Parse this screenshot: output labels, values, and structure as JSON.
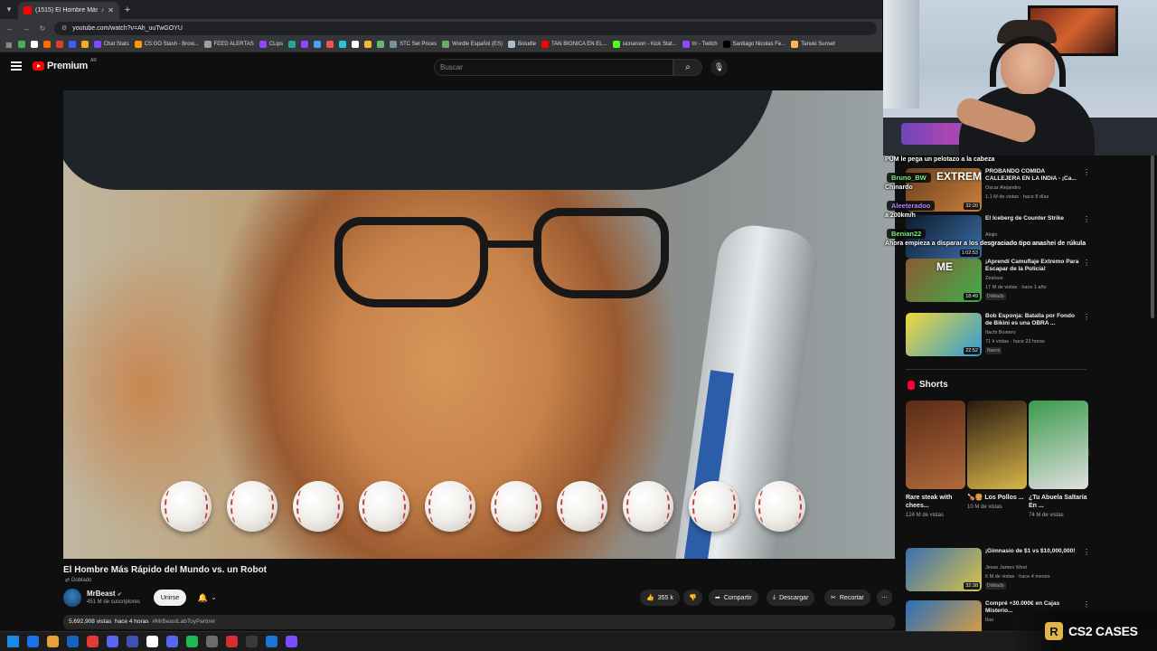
{
  "browser": {
    "tab_title": "(1515) El Hombre Más Rápi...",
    "url": "youtube.com/watch?v=Ah_uuTwGOYU",
    "bookmarks": [
      {
        "label": "",
        "color": "#4caf50"
      },
      {
        "label": "",
        "color": "#ffffff"
      },
      {
        "label": "",
        "color": "#ff6d00"
      },
      {
        "label": "",
        "color": "#e53935"
      },
      {
        "label": "",
        "color": "#3d5afe"
      },
      {
        "label": "",
        "color": "#f9a825"
      },
      {
        "label": "Chat Stats",
        "color": "#7c4dff"
      },
      {
        "label": "CS:GO Stash - Brow...",
        "color": "#ff9800"
      },
      {
        "label": "FEED ALERTAS",
        "color": "#9e9e9e"
      },
      {
        "label": "CLips",
        "color": "#9146ff"
      },
      {
        "label": "",
        "color": "#26a69a"
      },
      {
        "label": "",
        "color": "#9146ff"
      },
      {
        "label": "",
        "color": "#42a5f5"
      },
      {
        "label": "",
        "color": "#ef5350"
      },
      {
        "label": "",
        "color": "#26c6da"
      },
      {
        "label": "",
        "color": "#ffffff"
      },
      {
        "label": "",
        "color": "#f3ba2f"
      },
      {
        "label": "",
        "color": "#66bb6a"
      },
      {
        "label": "STC Set Prices",
        "color": "#78909c"
      },
      {
        "label": "Wordle Español (ES)",
        "color": "#6aaa64"
      },
      {
        "label": "Boludle",
        "color": "#b0bec5"
      },
      {
        "label": "TAN BIONICA EN EL...",
        "color": "#ff0000"
      },
      {
        "label": "sicnaroon - Kick Stat...",
        "color": "#53fc18"
      },
      {
        "label": "trr - Twitch",
        "color": "#9146ff"
      },
      {
        "label": "Santiago Nicolas Fe...",
        "color": "#000000"
      },
      {
        "label": "Tanuki Sunset",
        "color": "#ffb74d"
      }
    ]
  },
  "header": {
    "brand": "Premium",
    "country": "AR",
    "search_placeholder": "Buscar"
  },
  "video": {
    "title": "El Hombre Más Rápido del Mundo vs. un Robot",
    "dubbed": "Doblado",
    "channel": "MrBeast",
    "subscribers": "451 M de suscriptores",
    "join_label": "Unirse",
    "likes": "355 k",
    "share_label": "Compartir",
    "download_label": "Descargar",
    "clip_label": "Recortar",
    "views": "5,692,908 vistas",
    "age": "hace 4 horas",
    "hashtag": "#MrBeastLabToyPartner"
  },
  "recommendations": [
    {
      "title": "PROBANDO COMIDA CALLEJERA EN LA INDIA - ¡Ca...",
      "channel": "Oscar Alejandro",
      "meta": "1.1 M de vistas · hace 8 días",
      "duration": "32:20",
      "badge": "",
      "thumb_text": "EXTREMO!",
      "colors": [
        "#6b3f1f",
        "#c8803a"
      ]
    },
    {
      "title": "El Iceberg de Counter Strike",
      "channel": "Alojin",
      "meta": "3.6 k vistas · hace 22 horas",
      "duration": "1:02:53",
      "badge": "",
      "thumb_text": "",
      "colors": [
        "#0d1a2b",
        "#3b6ea8"
      ]
    },
    {
      "title": "¡Aprendí Camuflaje Extremo Para Escapar de la Policía!",
      "channel": "Zealous",
      "meta": "17 M de vistas · hace 1 año",
      "duration": "18:49",
      "badge": "Doblado",
      "thumb_text": "ME",
      "colors": [
        "#8a5b33",
        "#3fae4a"
      ]
    },
    {
      "title": "Bob Esponja: Batalla por Fondo de Bikini es una OBRA ...",
      "channel": "Itachi Bostero",
      "meta": "71 k vistas · hace 23 horas",
      "duration": "22:52",
      "badge": "Nuevo",
      "thumb_text": "",
      "colors": [
        "#f2d73a",
        "#2e9bd6"
      ]
    },
    {
      "title": "¡Gimnasio de $1 vs $10,000,000!",
      "channel": "Jesse James West",
      "meta": "6 M de vistas · hace 4 meses",
      "duration": "32:38",
      "badge": "Doblado",
      "thumb_text": "",
      "colors": [
        "#3a6fb0",
        "#d9c24a"
      ]
    },
    {
      "title": "Compré +30.000€ en Cajas Misterio...",
      "channel": "Ibai",
      "meta": "",
      "duration": "",
      "badge": "",
      "thumb_text": "",
      "colors": [
        "#2a6fb8",
        "#e8a23a"
      ]
    }
  ],
  "shorts": {
    "heading": "Shorts",
    "items": [
      {
        "title": "Rare steak with chees...",
        "views": "124 M de vistas",
        "colors": [
          "#5a2a18",
          "#b06a3a"
        ]
      },
      {
        "title": "🍗🍔 Los Pollos ...",
        "views": "10 M de vistas",
        "colors": [
          "#2a1a10",
          "#d8b54a"
        ]
      },
      {
        "title": "¿Tu Abuela Saltaría En ...",
        "views": "74 M de vistas",
        "colors": [
          "#3a9a4a",
          "#e0e0e0"
        ]
      }
    ]
  },
  "chat": [
    {
      "user": "",
      "text": "PUM le pega un pelotazo a la cabeza"
    },
    {
      "user": "Bruno_BW",
      "text": "Chinardo",
      "color": "#7cf07c"
    },
    {
      "user": "Aleeteradoo",
      "text": "a 200km/h",
      "color": "#b38cff"
    },
    {
      "user": "Benian22",
      "text": "Ahora empieza a disparar a los desgraciado tipo anashei de rúkula",
      "color": "#7cf07c"
    }
  ],
  "overlay": {
    "brand": "CS2 CASES",
    "logo_letter": "R"
  },
  "taskbar": [
    "#1e88e5",
    "#1a73e8",
    "#e8a23a",
    "#1565c0",
    "#e53935",
    "#5865f2",
    "#3f51b5",
    "#ffffff",
    "#5865f2",
    "#1db954",
    "#6c6c6c",
    "#d32f2f",
    "#3a3a3a",
    "#1976d2",
    "#7c4dff"
  ]
}
